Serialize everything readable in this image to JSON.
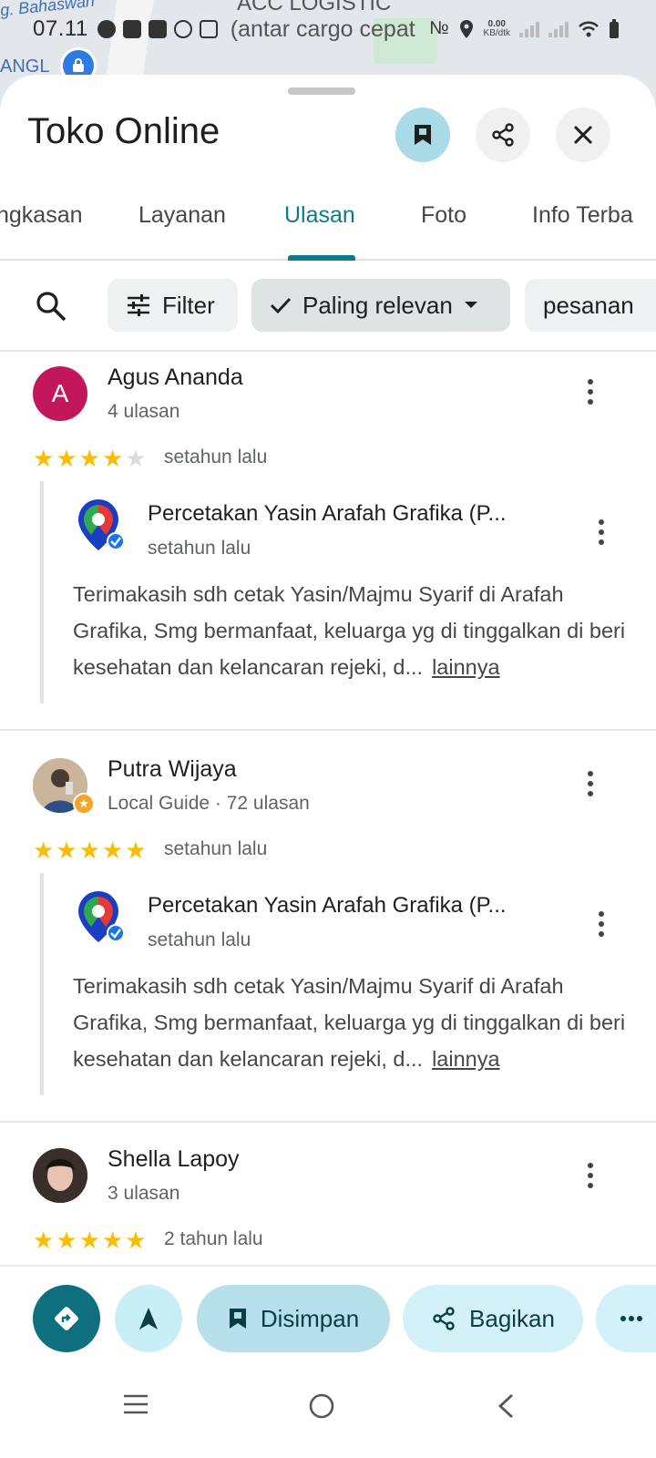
{
  "status_bar": {
    "time": "07.11",
    "speed_value": "0.00",
    "speed_unit": "KB/dtk"
  },
  "map": {
    "road_label": "g. Bahaswan",
    "place_label": "ANGL",
    "acc_label": "ACC LOGISTIC",
    "overlay_text": "(antar cargo cepat"
  },
  "sheet": {
    "title": "Toko Online",
    "tabs": [
      {
        "label": "ngkasan"
      },
      {
        "label": "Layanan"
      },
      {
        "label": "Ulasan",
        "active": true
      },
      {
        "label": "Foto"
      },
      {
        "label": "Info Terba"
      }
    ],
    "filters": {
      "filter_label": "Filter",
      "sort_label": "Paling relevan",
      "keyword_label": "pesanan"
    }
  },
  "reviews": [
    {
      "author": "Agus Ananda",
      "initial": "A",
      "meta": "4 ulasan",
      "rating": 4,
      "time": "setahun lalu",
      "reply": {
        "owner": "Percetakan Yasin Arafah Grafika (P...",
        "time": "setahun lalu",
        "text": "Terimakasih sdh cetak Yasin/Majmu Syarif di Arafah Grafika, Smg bermanfaat, keluarga yg di tinggalkan di beri kesehatan dan kelancaran rejeki, d...",
        "more": "lainnya"
      }
    },
    {
      "author": "Putra Wijaya",
      "meta": "Local Guide · 72 ulasan",
      "rating": 5,
      "time": "setahun lalu",
      "reply": {
        "owner": "Percetakan Yasin Arafah Grafika (P...",
        "time": "setahun lalu",
        "text": "Terimakasih sdh cetak Yasin/Majmu Syarif di Arafah Grafika, Smg bermanfaat, keluarga yg di tinggalkan di beri kesehatan dan kelancaran rejeki, d...",
        "more": "lainnya"
      }
    },
    {
      "author": "Shella Lapoy",
      "meta": "3 ulasan",
      "rating": 5,
      "time": "2 tahun lalu"
    }
  ],
  "actions": {
    "saved_label": "Disimpan",
    "share_label": "Bagikan"
  },
  "colors": {
    "accent": "#0b7a8a",
    "star": "#fbbc04",
    "avatar_a": "#c2185b"
  }
}
